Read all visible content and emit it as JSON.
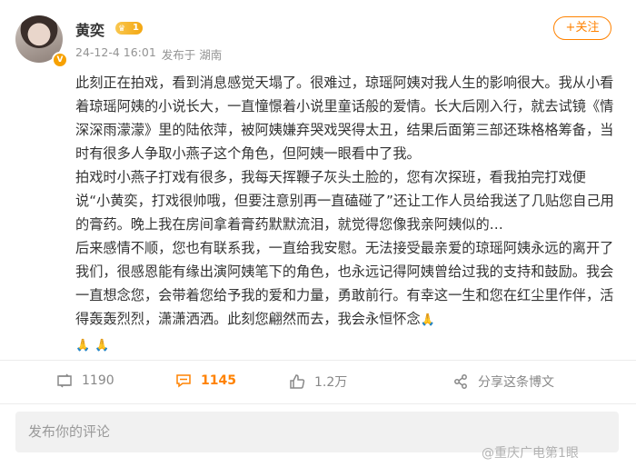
{
  "header": {
    "name": "黄奕",
    "level": "1",
    "verified_mark": "V",
    "timestamp": "24-12-4 16:01",
    "source": "发布于 湖南",
    "follow_label": "+关注"
  },
  "post": {
    "paragraphs": [
      "此刻正在拍戏，看到消息感觉天塌了。很难过，琼瑶阿姨对我人生的影响很大。我从小看着琼瑶阿姨的小说长大，一直憧憬着小说里童话般的爱情。长大后刚入行，就去试镜《情深深雨濛濛》里的陆依萍，被阿姨嫌弃哭戏哭得太丑，结果后面第三部还珠格格筹备，当时有很多人争取小燕子这个角色，但阿姨一眼看中了我。",
      "拍戏时小燕子打戏有很多，我每天挥鞭子灰头土脸的，您有次探班，看我拍完打戏便说“小黄奕，打戏很帅哦，但要注意别再一直磕碰了”还让工作人员给我送了几贴您自己用的膏药。晚上我在房间拿着膏药默默流泪，就觉得您像我亲阿姨似的…",
      "后来感情不顺，您也有联系我，一直给我安慰。无法接受最亲爱的琼瑶阿姨永远的离开了我们，很感恩能有缘出演阿姨笔下的角色，也永远记得阿姨曾给过我的支持和鼓励。我会一直想念您，会带着您给予我的爱和力量，勇敢前行。有幸这一生和您在红尘里作伴，活得轰轰烈烈，潇潇洒洒。此刻您翩然而去，我会永恒怀念"
    ]
  },
  "actions": {
    "repost_count": "1190",
    "comment_count": "1145",
    "like_count": "1.2万",
    "share_label": "分享这条博文"
  },
  "comment": {
    "placeholder": "发布你的评论"
  },
  "watermark": "@重庆广电第1眼"
}
